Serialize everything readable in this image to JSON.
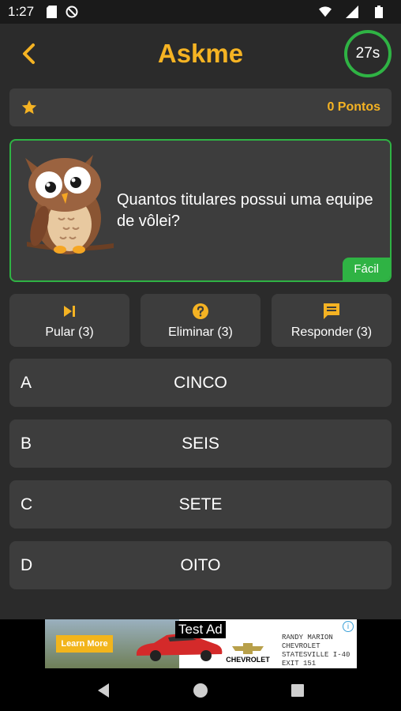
{
  "status": {
    "time": "1:27"
  },
  "app": {
    "title": "Askme",
    "timer": "27s"
  },
  "score": {
    "label": "0 Pontos"
  },
  "question": {
    "text": "Quantos titulares possui uma equipe de vôlei?",
    "level": "Fácil"
  },
  "helps": [
    {
      "label": "Pular (3)",
      "icon": "skip-icon"
    },
    {
      "label": "Eliminar (3)",
      "icon": "help-icon"
    },
    {
      "label": "Responder (3)",
      "icon": "chat-icon"
    }
  ],
  "answers": [
    {
      "letter": "A",
      "text": "CINCO"
    },
    {
      "letter": "B",
      "text": "SEIS"
    },
    {
      "letter": "C",
      "text": "SETE"
    },
    {
      "letter": "D",
      "text": "OITO"
    }
  ],
  "ad": {
    "test_label": "Test Ad",
    "cta": "Learn More",
    "brand": "CHEVROLET",
    "dealer_lines": [
      "RANDY MARION",
      "CHEVROLET",
      "STATESVILLE I-40",
      "EXIT 151"
    ],
    "info": "i"
  },
  "colors": {
    "accent": "#f5b323",
    "green": "#2fb344",
    "card": "#3d3d3d",
    "background": "#2b2b2b"
  }
}
